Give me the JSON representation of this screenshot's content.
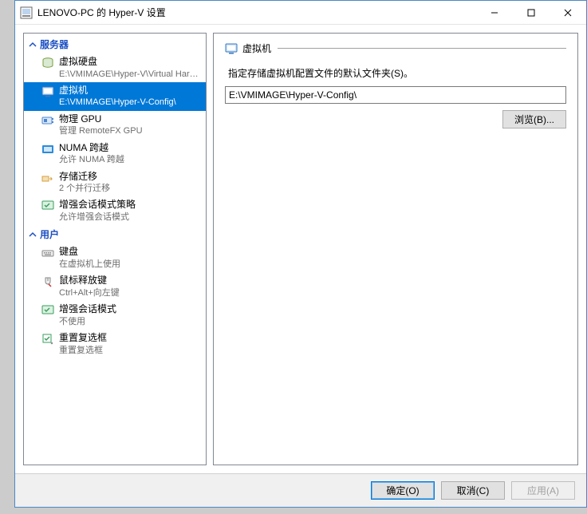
{
  "window": {
    "title": "LENOVO-PC 的 Hyper-V 设置"
  },
  "sidebar": {
    "sections": [
      {
        "header": "服务器",
        "items": [
          {
            "label": "虚拟硬盘",
            "sub": "E:\\VMIMAGE\\Hyper-V\\Virtual Hard ...",
            "icon": "disk"
          },
          {
            "label": "虚拟机",
            "sub": "E:\\VMIMAGE\\Hyper-V-Config\\",
            "icon": "vm",
            "selected": true
          },
          {
            "label": "物理 GPU",
            "sub": "管理 RemoteFX GPU",
            "icon": "gpu"
          },
          {
            "label": "NUMA 跨越",
            "sub": "允许 NUMA 跨越",
            "icon": "numa"
          },
          {
            "label": "存储迁移",
            "sub": "2 个并行迁移",
            "icon": "migrate"
          },
          {
            "label": "增强会话模式策略",
            "sub": "允许增强会话模式",
            "icon": "enhanced"
          }
        ]
      },
      {
        "header": "用户",
        "items": [
          {
            "label": "键盘",
            "sub": "在虚拟机上使用",
            "icon": "keyboard"
          },
          {
            "label": "鼠标释放键",
            "sub": "Ctrl+Alt+向左键",
            "icon": "mouse"
          },
          {
            "label": "增强会话模式",
            "sub": "不使用",
            "icon": "enhanced"
          },
          {
            "label": "重置复选框",
            "sub": "重置复选框",
            "icon": "reset"
          }
        ]
      }
    ]
  },
  "main": {
    "group_title": "虚拟机",
    "description": "指定存储虚拟机配置文件的默认文件夹(S)。",
    "path_value": "E:\\VMIMAGE\\Hyper-V-Config\\",
    "browse_label": "浏览(B)..."
  },
  "footer": {
    "ok": "确定(O)",
    "cancel": "取消(C)",
    "apply": "应用(A)"
  },
  "icons": {
    "disk": "#7a9e3e",
    "vm": "#3a78c2",
    "gpu": "#4a86d0",
    "numa": "#2e8bd8",
    "migrate": "#d9a13b",
    "enhanced": "#3a9e5e",
    "keyboard": "#888888",
    "mouse": "#888888",
    "reset": "#3a9e5e"
  }
}
